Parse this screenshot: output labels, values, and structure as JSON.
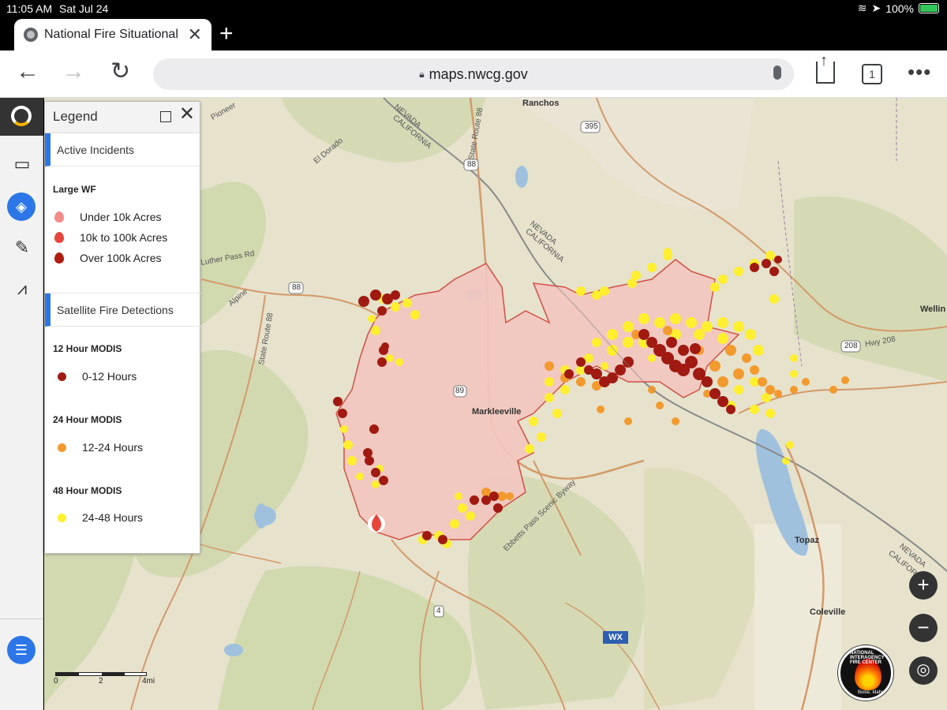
{
  "status_bar": {
    "time": "11:05 AM",
    "date": "Sat Jul 24",
    "battery": "100%"
  },
  "browser": {
    "tab_title": "National Fire Situational",
    "tab_close": "✕",
    "new_tab": "+",
    "url": "maps.nwcg.gov",
    "tab_count": "1",
    "more": "•••"
  },
  "legend": {
    "title": "Legend",
    "section_active": "Active Incidents",
    "large_wf": "Large WF",
    "wf_items": [
      "Under 10k Acres",
      "10k to 100k Acres",
      "Over 100k Acres"
    ],
    "section_satellite": "Satellite Fire Detections",
    "modis": [
      {
        "heading": "12 Hour MODIS",
        "label": "0-12 Hours",
        "color": "#a01a12"
      },
      {
        "heading": "24 Hour MODIS",
        "label": "12-24 Hours",
        "color": "#f29a2e"
      },
      {
        "heading": "48 Hour MODIS",
        "label": "24-48 Hours",
        "color": "#ffef2e"
      }
    ],
    "wf_colors": [
      "#f28a85",
      "#e8453c",
      "#b11c10"
    ]
  },
  "map": {
    "labels": {
      "ranchos": "Ranchos",
      "markleeville": "Markleeville",
      "topaz": "Topaz",
      "coleville": "Coleville",
      "wellington": "Wellin",
      "el_dorado": "El Dorado",
      "nevada1": "NEVADA",
      "california1": "CALIFORNIA",
      "nevada2": "NEVADA",
      "california2": "CALIFORNIA",
      "nevada3": "NEVADA",
      "california3": "CALIFORNIA",
      "state_route_88": "State Route 88",
      "state_route_88b": "State Route 88",
      "luther_pass": "Luther Pass Rd",
      "alpine": "Alpine",
      "pioneer": "Pioneer",
      "hwy_208": "Hwy 208",
      "ebbetts": "Ebbetts Pass Scenic Byway",
      "shield_395": "395",
      "shield_88a": "88",
      "shield_88b": "88",
      "shield_89": "89",
      "shield_208": "208",
      "shield_4": "4"
    },
    "wx": "WX",
    "scale": [
      "0",
      "2",
      "4mi"
    ],
    "logo_text": "NATIONAL INTERAGENCY FIRE CENTER",
    "logo_sub": "Boise, Idaho",
    "colors": {
      "perimeter_fill": "#f3c7c0",
      "perimeter_line": "#d0453a",
      "road": "#d39a6a",
      "water": "#9fc1de",
      "terrain": "#e6e2cc",
      "forest": "#c9d6a5"
    }
  },
  "controls": {
    "zoom_in": "+",
    "zoom_out": "−",
    "locate": "◎"
  }
}
